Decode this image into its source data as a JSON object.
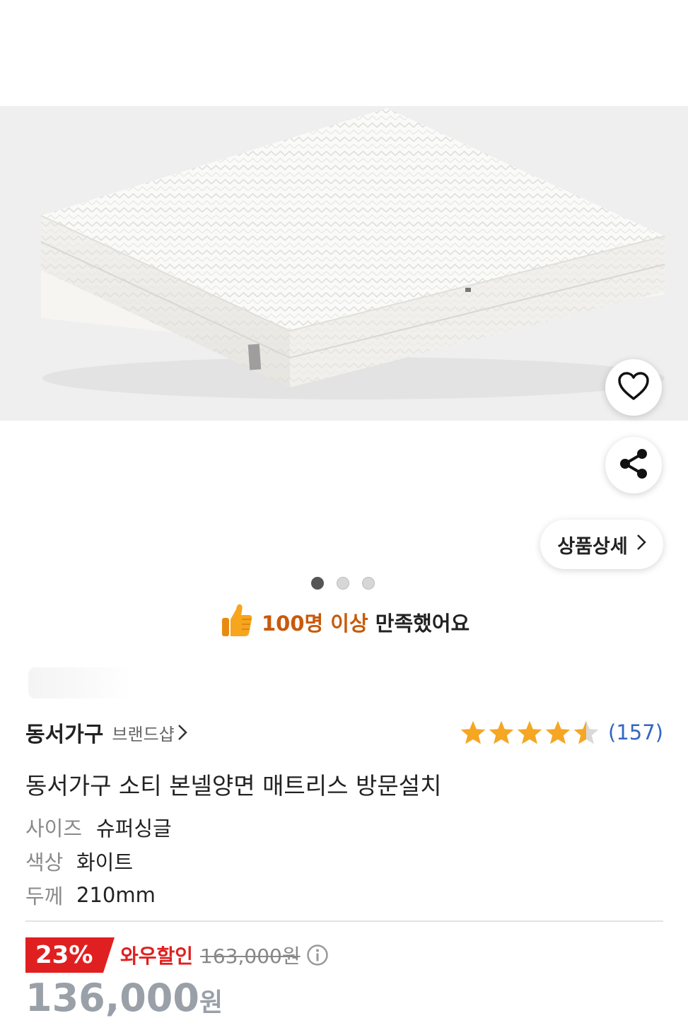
{
  "product_image": {
    "description_icon": "mattress-photo"
  },
  "actions": {
    "wishlist_icon": "heart-icon",
    "share_icon": "share-icon",
    "detail_label": "상품상세"
  },
  "carousel": {
    "total": 3,
    "active_index": 0
  },
  "satisfaction": {
    "icon": "thumbs-up-icon",
    "count_text": "100명 이상",
    "text": "만족했어요"
  },
  "brand": {
    "name": "동서가구",
    "shop_link": "브랜드샵"
  },
  "rating": {
    "stars": 4.5,
    "review_count": "(157)"
  },
  "product": {
    "title": "동서가구 소티 본넬양면 매트리스 방문설치"
  },
  "options": [
    {
      "label": "사이즈",
      "value": "슈퍼싱글"
    },
    {
      "label": "색상",
      "value": "화이트"
    },
    {
      "label": "두께",
      "value": "210mm"
    }
  ],
  "price": {
    "discount": "23%",
    "wow_label": "와우할인",
    "original": "163,000원",
    "final": "136,000",
    "unit": "원"
  },
  "colors": {
    "satisfaction_accent": "#c85a0b",
    "discount_badge": "#e02020",
    "review_link": "#3466c4",
    "star": "#f5a623"
  }
}
